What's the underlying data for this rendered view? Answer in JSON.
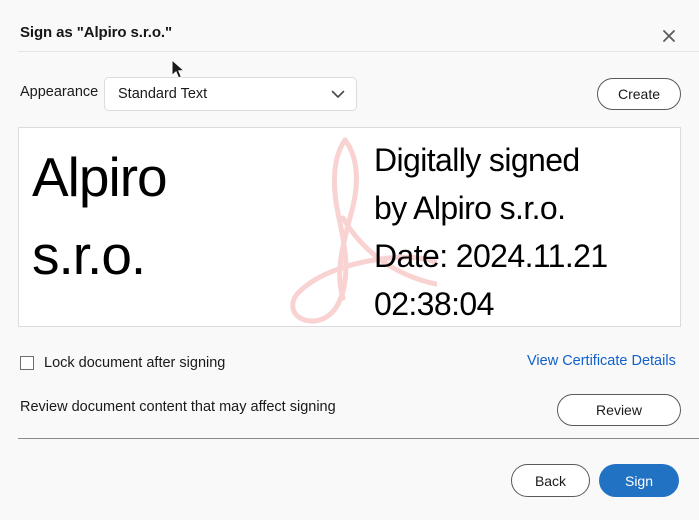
{
  "dialog": {
    "title": "Sign as \"Alpiro s.r.o.\"",
    "close_icon": "close-icon"
  },
  "appearance": {
    "label": "Appearance",
    "selected_option": "Standard Text",
    "options": [
      "Standard Text"
    ],
    "chevron_icon": "chevron-down-icon",
    "create_label": "Create"
  },
  "signature_preview": {
    "name_line_1": "Alpiro",
    "name_line_2": "s.r.o.",
    "details": [
      "Digitally signed",
      "by Alpiro s.r.o.",
      "Date: 2024.11.21",
      "02:38:04"
    ],
    "watermark_icon": "adobe-a-watermark-icon",
    "watermark_color": "#f9d3d3"
  },
  "options": {
    "lock_document_label": "Lock document after signing",
    "lock_document_checked": false,
    "view_certificate_label": "View Certificate Details",
    "link_color": "#1260cc",
    "review_text": "Review document content that may affect signing",
    "review_button_label": "Review"
  },
  "footer": {
    "back_label": "Back",
    "sign_label": "Sign",
    "sign_color": "#2272c4"
  },
  "cursor": {
    "icon": "mouse-pointer-icon"
  }
}
